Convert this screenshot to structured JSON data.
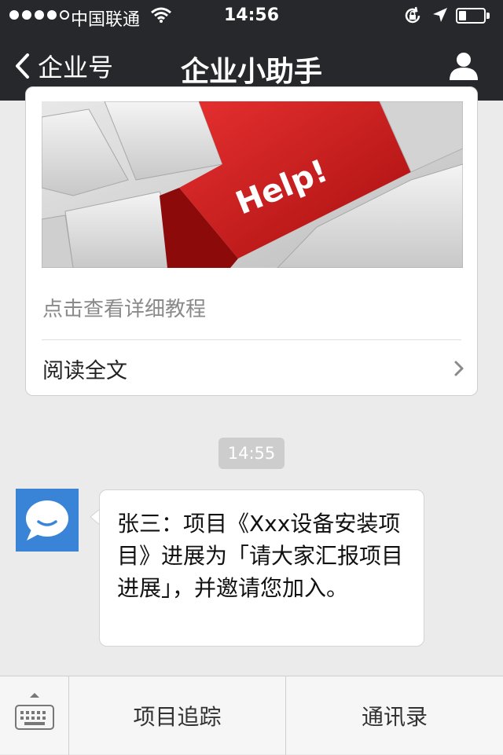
{
  "status_bar": {
    "carrier": "中国联通",
    "time": "14:56",
    "signal_bars_filled": 4,
    "signal_bars_total": 5,
    "battery_level": 0.3,
    "icons": [
      "wifi-icon",
      "rotation-lock-icon",
      "location-arrow-icon",
      "battery-icon"
    ]
  },
  "nav": {
    "back_label": "企业号",
    "title": "企业小助手",
    "back_icon": "chevron-left-icon",
    "right_icon": "profile-icon"
  },
  "article": {
    "image_icon": "help-keyboard-image",
    "image_key_text": "Help!",
    "description": "点击查看详细教程",
    "read_more_label": "阅读全文",
    "read_more_icon": "chevron-right-icon"
  },
  "chat": {
    "timestamp": "14:55",
    "messages": [
      {
        "avatar_icon": "speech-bubble-smile-icon",
        "text": "张三：项目《Xxx设备安装项目》进展为「请大家汇报项目进展」，并邀请您加入。"
      }
    ]
  },
  "toolbar": {
    "keyboard_icon": "keyboard-icon",
    "items": [
      {
        "label": "项目追踪"
      },
      {
        "label": "通讯录"
      }
    ]
  },
  "colors": {
    "nav_background": "#26282c",
    "page_background": "#ebebeb",
    "avatar_blue": "#3a84d8",
    "help_key_red": "#d81e1e"
  }
}
